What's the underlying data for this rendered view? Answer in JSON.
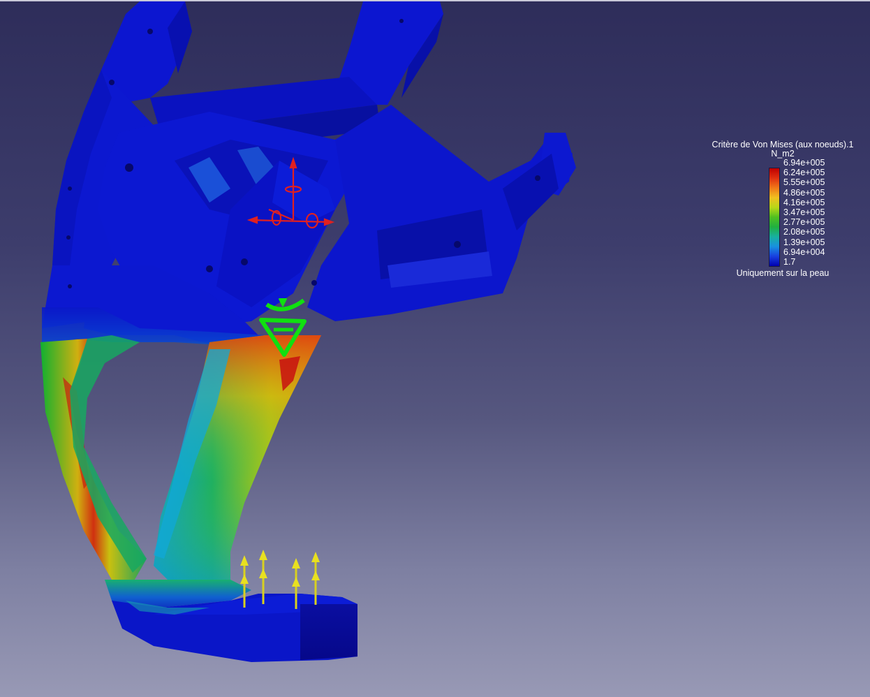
{
  "legend": {
    "title": "Critère de Von Mises (aux noeuds).1",
    "unit": "N_m2",
    "values": [
      "6.94e+005",
      "6.24e+005",
      "5.55e+005",
      "4.86e+005",
      "4.16e+005",
      "3.47e+005",
      "2.77e+005",
      "2.08e+005",
      "1.39e+005",
      "6.94e+004",
      "1.7"
    ],
    "colors": [
      "#c00000",
      "#e03010",
      "#f07818",
      "#f0c020",
      "#b8d818",
      "#50c020",
      "#20b040",
      "#18b0a0",
      "#1890e0",
      "#1840e0",
      "#0000b0"
    ],
    "note": "Uniquement sur la peau"
  },
  "icons": {
    "compass": "axis-compass-icon",
    "clamp": "fixed-restraint-icon",
    "loads": "force-arrow-icon"
  },
  "colors": {
    "background_top": "#2e2d5a",
    "background_bottom": "#9899b5",
    "part_low_stress": "#0c14c8",
    "compass": "#e02020",
    "restraint": "#10e010",
    "force_arrows": "#e8e020"
  }
}
